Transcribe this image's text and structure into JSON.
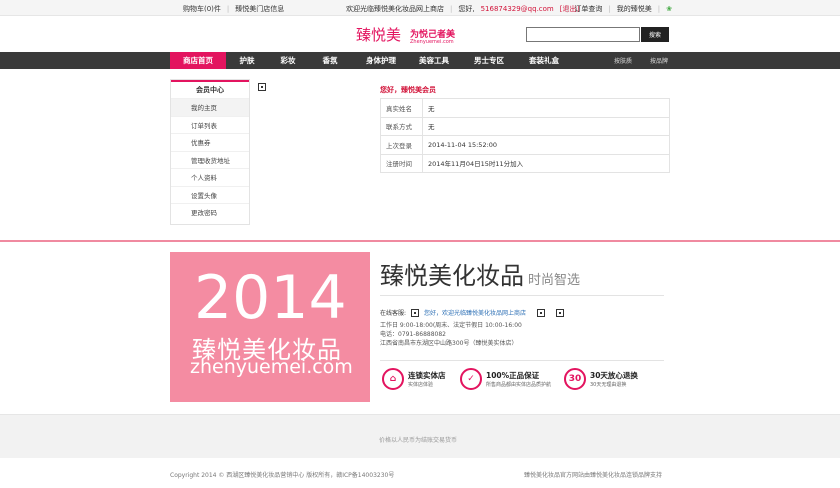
{
  "topbar": {
    "cart": "购物车(0)件",
    "stores": "臻悦美门店信息",
    "welcome": "欢迎光临臻悦美化妆品网上商店",
    "hello": "您好,",
    "email": "516874329@qq.com",
    "logout": "[退出]",
    "orders": "订单查询",
    "my": "我的臻悦美"
  },
  "header": {
    "logo_main": "臻悦美",
    "logo_slogan": "为悦己者美",
    "logo_url": "Zhenyuemei.com",
    "search_placeholder": "",
    "search_button": "搜索"
  },
  "nav": {
    "items": [
      "商店首页",
      "护肤",
      "彩妆",
      "香氛",
      "身体护理",
      "美容工具",
      "男士专区",
      "套装礼盒"
    ],
    "right": [
      "按肤质",
      "按品牌"
    ]
  },
  "sidebar": {
    "title": "会员中心",
    "items": [
      "我的主页",
      "订单列表",
      "优惠券",
      "管理收货地址",
      "个人资料",
      "设置头像",
      "更改密码"
    ]
  },
  "profile": {
    "welcome": "您好，臻悦美会员",
    "rows": [
      {
        "k": "真实姓名",
        "v": "无"
      },
      {
        "k": "联系方式",
        "v": "无"
      },
      {
        "k": "上次登录",
        "v": "2014-11-04 15:52:00"
      },
      {
        "k": "注册时间",
        "v": "2014年11月04日15时11分加入"
      }
    ]
  },
  "banner": {
    "year": "2014",
    "cn": "臻悦美化妆品",
    "url": "zhenyuemei.com"
  },
  "brand": {
    "title": "臻悦美化妆品",
    "subtitle": "时尚智选"
  },
  "service": {
    "label": "在线客服:",
    "text": "您好，欢迎光临臻悦美化妆品网上商店"
  },
  "contact": {
    "hours": "工作日 9:00-18:00(周末、法定节假日 10:00-16:00",
    "phone": "电话：0791-86888082",
    "address": "江西省南昌市东湖区中山路300号（臻悦美实体店）"
  },
  "features": [
    {
      "icon": "store-icon",
      "title": "连锁实体店",
      "sub": "实体店体验"
    },
    {
      "icon": "shield-icon",
      "title": "100%正品保证",
      "sub": "所售商品都由实体店品质护航"
    },
    {
      "icon": "30",
      "title": "30天放心退换",
      "sub": "30天无理由退换"
    }
  ],
  "graybar": {
    "text": "价格以人民币为结账交易货币"
  },
  "footer": {
    "left": "Copyright 2014 © 西湖区臻悦美化妆品营销中心 版权所有，赣ICP备14003230号",
    "right": "臻悦美化妆品官方网站由臻悦美化妆品连锁品牌支持"
  },
  "colors": {
    "accent": "#e3145f",
    "nav": "#3a3a3a",
    "banner": "#f48ca2"
  }
}
